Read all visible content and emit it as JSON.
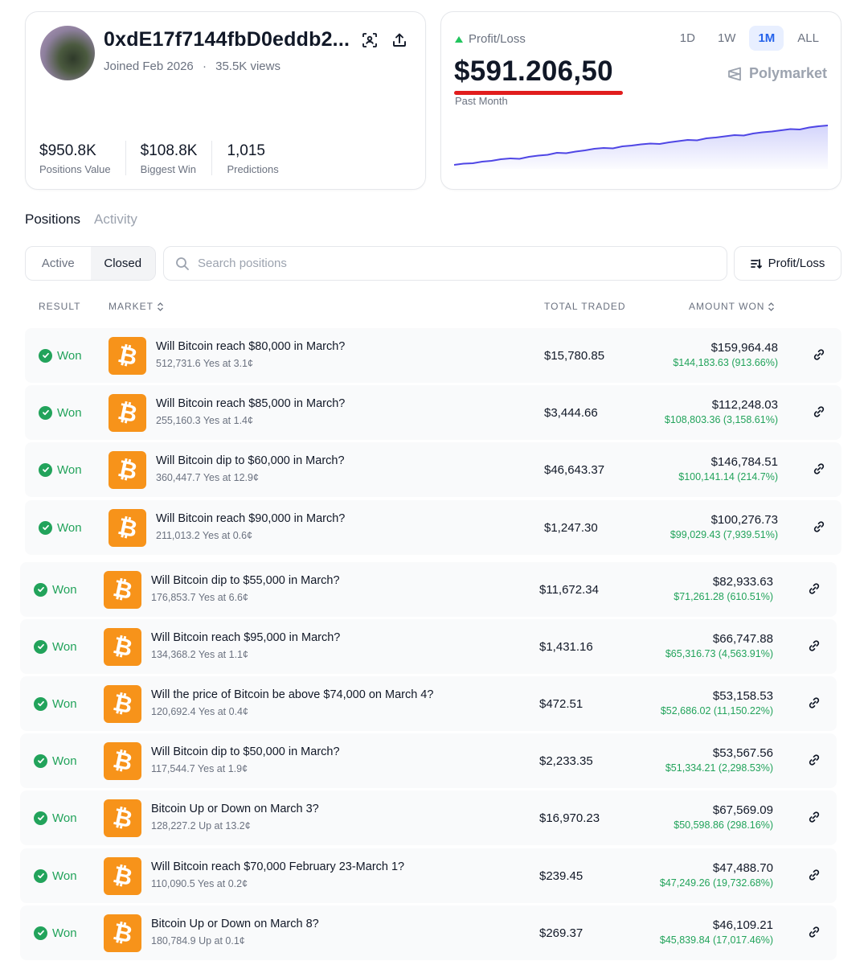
{
  "profile": {
    "username": "0xdE17f7144fbD0eddb2...",
    "joined": "Joined Feb 2026",
    "views": "35.5K views",
    "separator": "·",
    "stats": [
      {
        "value": "$950.8K",
        "label": "Positions Value"
      },
      {
        "value": "$108.8K",
        "label": "Biggest Win"
      },
      {
        "value": "1,015",
        "label": "Predictions"
      }
    ]
  },
  "pnl": {
    "label": "Profit/Loss",
    "value": "$591.206,50",
    "period": "Past Month",
    "brand": "Polymarket",
    "ranges": [
      "1D",
      "1W",
      "1M",
      "ALL"
    ],
    "active_range": "1M",
    "trend": [
      0.02,
      0.05,
      0.06,
      0.1,
      0.12,
      0.16,
      0.18,
      0.17,
      0.22,
      0.25,
      0.27,
      0.32,
      0.31,
      0.35,
      0.38,
      0.42,
      0.44,
      0.43,
      0.48,
      0.5,
      0.53,
      0.55,
      0.54,
      0.58,
      0.61,
      0.64,
      0.63,
      0.68,
      0.7,
      0.73,
      0.76,
      0.75,
      0.8,
      0.83,
      0.85,
      0.88,
      0.91,
      0.9,
      0.95,
      0.98,
      1.0
    ]
  },
  "colors": {
    "accent": "#2563eb",
    "positive": "#22a35b",
    "highlight": "#e11d1d",
    "bitcoin": "#f7931a"
  },
  "tabs": [
    "Positions",
    "Activity"
  ],
  "filters": {
    "active": "Active",
    "closed": "Closed"
  },
  "search": {
    "placeholder": "Search positions"
  },
  "sort": {
    "label": "Profit/Loss"
  },
  "columns": {
    "result": "RESULT",
    "market": "MARKET",
    "total_traded": "TOTAL TRADED",
    "amount_won": "AMOUNT WON"
  },
  "rows": [
    {
      "result": "Won",
      "title": "Will Bitcoin reach $80,000 in March?",
      "sub": "512,731.6 Yes at 3.1¢",
      "traded": "$15,780.85",
      "won": "$159,964.48",
      "gain": "$144,183.63 (913.66%)"
    },
    {
      "result": "Won",
      "title": "Will Bitcoin reach $85,000 in March?",
      "sub": "255,160.3 Yes at 1.4¢",
      "traded": "$3,444.66",
      "won": "$112,248.03",
      "gain": "$108,803.36 (3,158.61%)"
    },
    {
      "result": "Won",
      "title": "Will Bitcoin dip to $60,000 in March?",
      "sub": "360,447.7 Yes at 12.9¢",
      "traded": "$46,643.37",
      "won": "$146,784.51",
      "gain": "$100,141.14 (214.7%)"
    },
    {
      "result": "Won",
      "title": "Will Bitcoin reach $90,000 in March?",
      "sub": "211,013.2 Yes at 0.6¢",
      "traded": "$1,247.30",
      "won": "$100,276.73",
      "gain": "$99,029.43 (7,939.51%)"
    },
    {
      "result": "Won",
      "title": "Will Bitcoin dip to $55,000 in March?",
      "sub": "176,853.7 Yes at 6.6¢",
      "traded": "$11,672.34",
      "won": "$82,933.63",
      "gain": "$71,261.28 (610.51%)"
    },
    {
      "result": "Won",
      "title": "Will Bitcoin reach $95,000 in March?",
      "sub": "134,368.2 Yes at 1.1¢",
      "traded": "$1,431.16",
      "won": "$66,747.88",
      "gain": "$65,316.73 (4,563.91%)"
    },
    {
      "result": "Won",
      "title": "Will the price of Bitcoin be above $74,000 on March 4?",
      "sub": "120,692.4 Yes at 0.4¢",
      "traded": "$472.51",
      "won": "$53,158.53",
      "gain": "$52,686.02 (11,150.22%)"
    },
    {
      "result": "Won",
      "title": "Will Bitcoin dip to $50,000 in March?",
      "sub": "117,544.7 Yes at 1.9¢",
      "traded": "$2,233.35",
      "won": "$53,567.56",
      "gain": "$51,334.21 (2,298.53%)"
    },
    {
      "result": "Won",
      "title": "Bitcoin Up or Down on March 3?",
      "sub": "128,227.2 Up at 13.2¢",
      "traded": "$16,970.23",
      "won": "$67,569.09",
      "gain": "$50,598.86 (298.16%)"
    },
    {
      "result": "Won",
      "title": "Will Bitcoin reach $70,000 February 23-March 1?",
      "sub": "110,090.5 Yes at 0.2¢",
      "traded": "$239.45",
      "won": "$47,488.70",
      "gain": "$47,249.26 (19,732.68%)"
    },
    {
      "result": "Won",
      "title": "Bitcoin Up or Down on March 8?",
      "sub": "180,784.9 Up at 0.1¢",
      "traded": "$269.37",
      "won": "$46,109.21",
      "gain": "$45,839.84 (17,017.46%)"
    }
  ]
}
